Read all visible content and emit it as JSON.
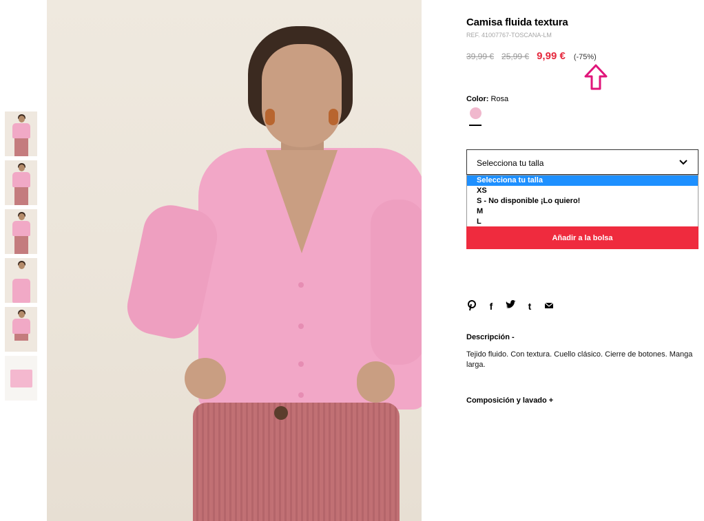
{
  "product": {
    "title": "Camisa fluida textura",
    "ref": "REF. 41007767-TOSCANA-LM",
    "price_original": "39,99 €",
    "price_previous": "25,99 €",
    "price_current": "9,99 €",
    "discount": "(-75%)"
  },
  "color": {
    "label": "Color:",
    "value": "Rosa",
    "swatch_hex": "#f0b8cd"
  },
  "size_select": {
    "selected": "Selecciona tu talla",
    "options": [
      "Selecciona tu talla",
      "XS",
      "S - No disponible ¡Lo quiero!",
      "M",
      "L"
    ]
  },
  "actions": {
    "add_to_bag": "Añadir a la bolsa"
  },
  "social": {
    "icons": [
      "pinterest-icon",
      "facebook-icon",
      "twitter-icon",
      "tumblr-icon",
      "email-icon"
    ],
    "glyphs": [
      "𝒑",
      "f",
      "🐦",
      "t",
      "✉"
    ]
  },
  "description": {
    "heading": "Descripción -",
    "text": "Tejido fluido. Con textura. Cuello clásico. Cierre de botones. Manga larga."
  },
  "composition": {
    "heading": "Composición y lavado +"
  },
  "colors": {
    "accent_red": "#ef2b3e",
    "price_red": "#e5283d",
    "annotation_magenta": "#e0157a",
    "select_highlight": "#1e90ff"
  }
}
